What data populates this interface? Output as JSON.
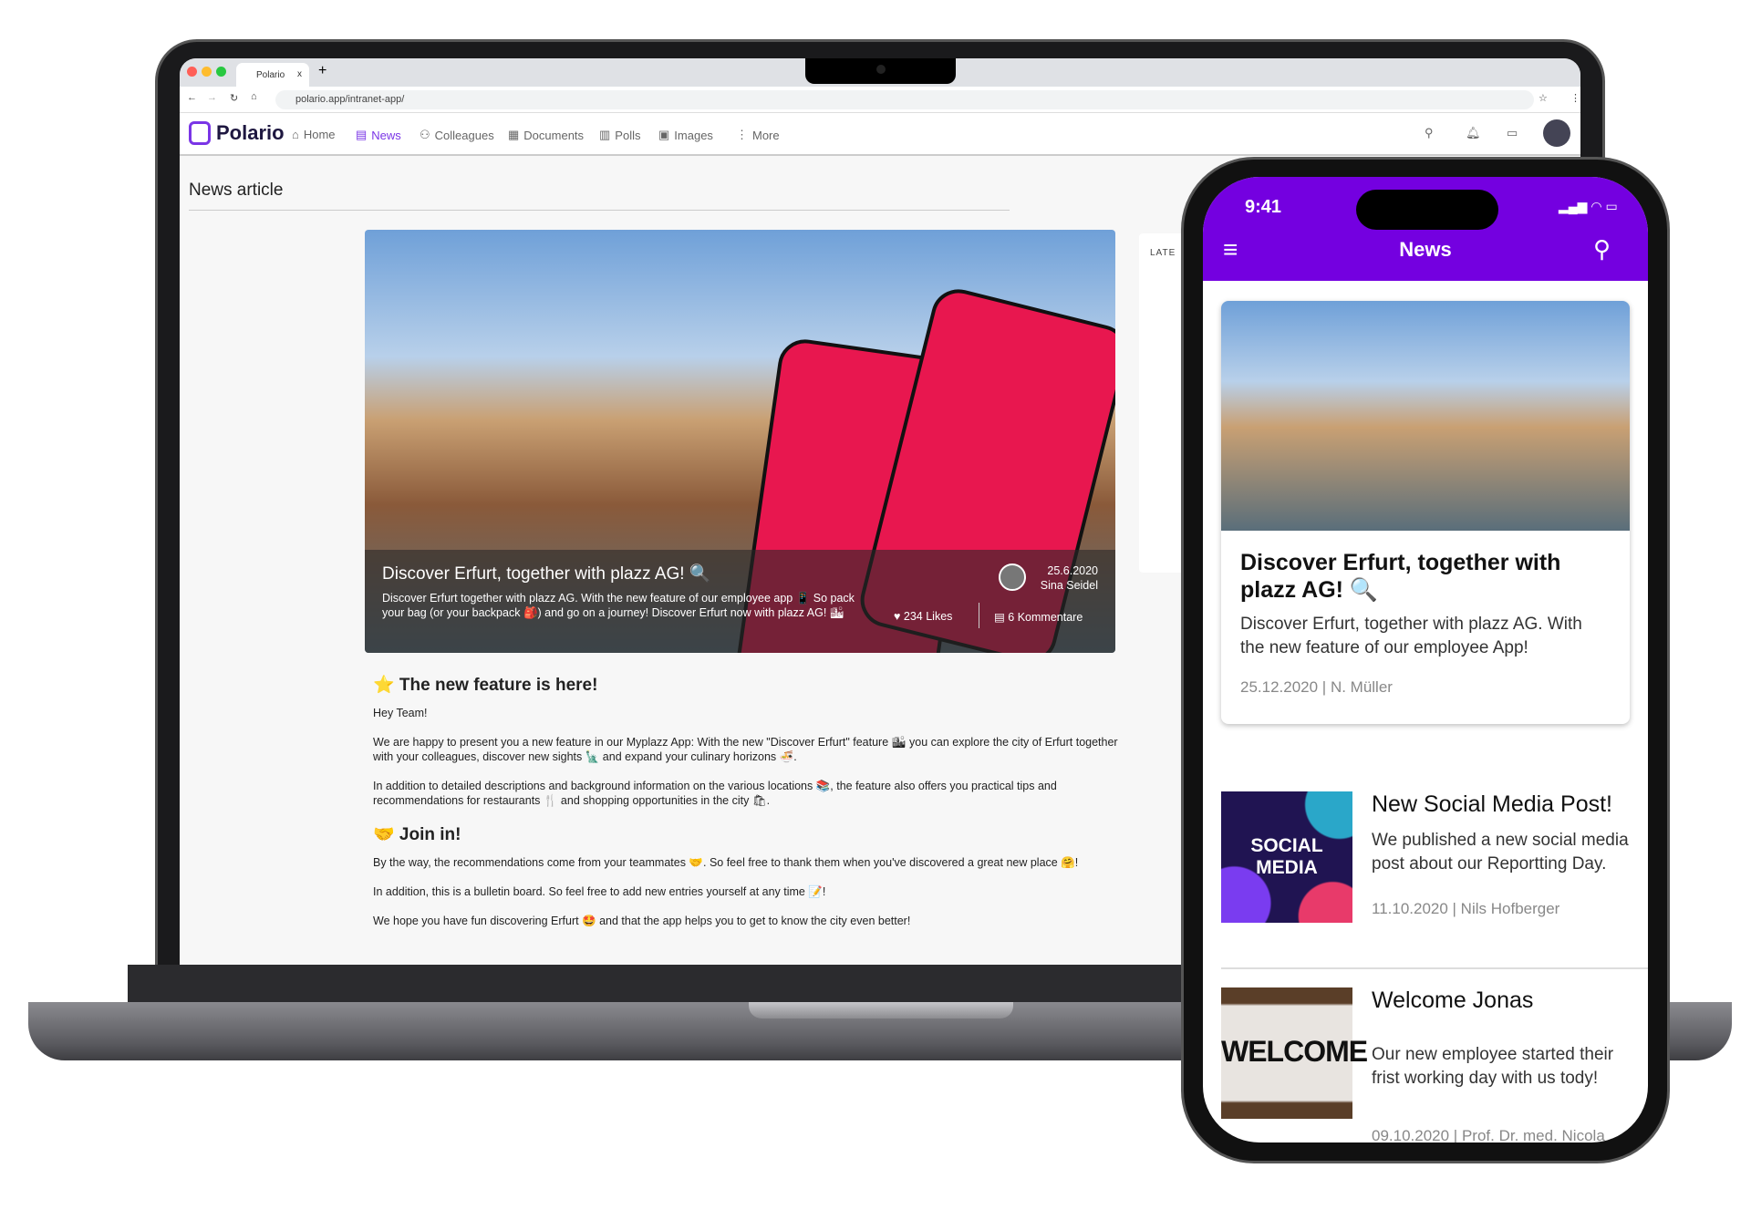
{
  "browser": {
    "tab_title": "Polario",
    "tab_close": "x",
    "new_tab": "+",
    "url": "polario.app/intranet-app/"
  },
  "nav": {
    "logo": "Polario",
    "items": [
      {
        "label": "Home",
        "icon": "home-icon"
      },
      {
        "label": "News",
        "icon": "news-icon",
        "active": true
      },
      {
        "label": "Colleagues",
        "icon": "people-icon"
      },
      {
        "label": "Documents",
        "icon": "document-icon"
      },
      {
        "label": "Polls",
        "icon": "bar-chart-icon"
      },
      {
        "label": "Images",
        "icon": "image-icon"
      },
      {
        "label": "More",
        "icon": "more-vertical-icon"
      }
    ],
    "accent": "#7a35e6"
  },
  "page": {
    "breadcrumb": "News article",
    "side_label": "LATE"
  },
  "hero": {
    "title": "Discover Erfurt, together with plazz AG! 🔍",
    "text": "Discover Erfurt together with plazz AG. With the new feature of our employee app 📱 So pack your bag (or your backpack 🎒) and go on a journey! Discover Erfurt now with plazz AG! 🏙",
    "date": "25.6.2020",
    "author": "Sina Seidel",
    "likes": "234 Likes",
    "comments": "6 Kommentare"
  },
  "article": {
    "h1": "⭐ The new feature is here!",
    "p1": "Hey Team!",
    "p2": "We are happy to present you a new feature in our Myplazz App: With the new \"Discover Erfurt\" feature 🏙 you can explore the city of Erfurt together with your colleagues, discover new sights 🗽 and expand your culinary horizons 🍜.",
    "p3": "In addition to detailed descriptions and background information on the various locations 📚, the feature also offers you practical tips and recommendations for restaurants 🍴 and shopping opportunities in the city 🛍.",
    "h2": "🤝 Join in!",
    "p4": "By the way, the recommendations come from your teammates 🤝. So feel free to thank them when you've discovered a great new place 🤗!",
    "p5": "In addition, this is a bulletin board. So feel free to add new entries yourself at any time 📝!",
    "p6": "We hope you have fun discovering Erfurt 🤩 and that the app helps you to get to know the city even better!"
  },
  "phone": {
    "time": "9:41",
    "title": "News",
    "header_color": "#7400e0",
    "featured": {
      "title": "Discover Erfurt, together with plazz AG! 🔍",
      "text": "Discover Erfurt, together with plazz AG. With the new feature of our employee  App!",
      "meta": "25.12.2020 | N. Müller"
    },
    "items": [
      {
        "thumb": "SOCIAL MEDIA",
        "title": "New Social Media Post!",
        "text": "We published a new social media post about our Reportting Day.",
        "meta": "11.10.2020 | Nils Hofberger"
      },
      {
        "thumb": "WELCOME",
        "title": "Welcome Jonas",
        "text": "Our new employee started their frist working day with us  tody!",
        "meta": "09.10.2020 | Prof. Dr. med. Nicola"
      }
    ]
  }
}
